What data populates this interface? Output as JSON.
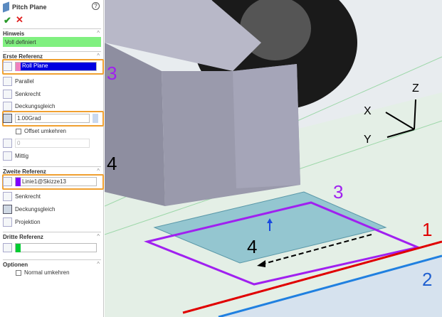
{
  "panel": {
    "title": "Pitch Plane",
    "help_icon": "?",
    "hinweis": {
      "header": "Hinweis",
      "status": "Voll definiert"
    },
    "erste": {
      "header": "Erste Referenz",
      "value": "Roll Plane",
      "parallel": "Parallel",
      "senkrecht": "Senkrecht",
      "deckungsgleich": "Deckungsgleich",
      "angle": "1.00Grad",
      "offset_umkehren": "Offset umkehren",
      "distance": "0",
      "mittig": "Mittig"
    },
    "zweite": {
      "header": "Zweite Referenz",
      "value": "Linie1@Skizze13",
      "senkrecht": "Senkrecht",
      "deckungsgleich": "Deckungsgleich",
      "projektion": "Projektion"
    },
    "dritte": {
      "header": "Dritte Referenz",
      "value": ""
    },
    "optionen": {
      "header": "Optionen",
      "normal_umkehren": "Normal umkehren"
    }
  },
  "annotations": {
    "a3_panel": "3",
    "a4_panel": "4",
    "a3_view": "3",
    "a4_view": "4",
    "a1": "1",
    "a2": "2"
  },
  "axes": {
    "x": "X",
    "y": "Y",
    "z": "Z"
  },
  "colors": {
    "first_ref": "#f080c0",
    "second_ref": "#8000ff",
    "third_ref": "#00cc33",
    "highlight": "#f0a030",
    "status_bg": "#80f080"
  }
}
